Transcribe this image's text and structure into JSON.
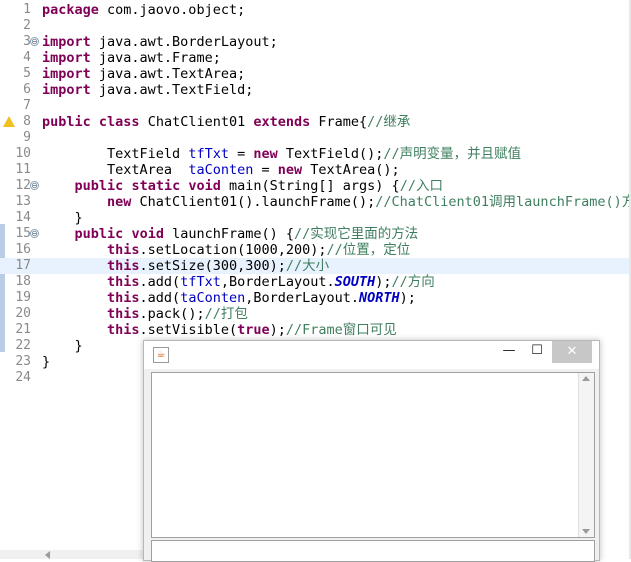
{
  "editor": {
    "lines": [
      {
        "n": "1",
        "segs": [
          {
            "t": "package",
            "c": "kw"
          },
          {
            "t": " com.jaovo.object;",
            "c": ""
          }
        ]
      },
      {
        "n": "2",
        "segs": []
      },
      {
        "n": "3",
        "fold": "⊖",
        "segs": [
          {
            "t": "import",
            "c": "kw"
          },
          {
            "t": " java.awt.BorderLayout;",
            "c": ""
          }
        ]
      },
      {
        "n": "4",
        "segs": [
          {
            "t": "import",
            "c": "kw"
          },
          {
            "t": " java.awt.Frame;",
            "c": ""
          }
        ]
      },
      {
        "n": "5",
        "segs": [
          {
            "t": "import",
            "c": "kw"
          },
          {
            "t": " java.awt.TextArea;",
            "c": ""
          }
        ]
      },
      {
        "n": "6",
        "segs": [
          {
            "t": "import",
            "c": "kw"
          },
          {
            "t": " java.awt.TextField;",
            "c": ""
          }
        ]
      },
      {
        "n": "7",
        "segs": []
      },
      {
        "n": "8",
        "warn": true,
        "segs": [
          {
            "t": "public",
            "c": "kw"
          },
          {
            "t": " ",
            "c": ""
          },
          {
            "t": "class",
            "c": "kw"
          },
          {
            "t": " ChatClient01 ",
            "c": ""
          },
          {
            "t": "extends",
            "c": "kw"
          },
          {
            "t": " Frame{",
            "c": ""
          },
          {
            "t": "//继承",
            "c": "cm"
          }
        ]
      },
      {
        "n": "9",
        "segs": []
      },
      {
        "n": "10",
        "segs": [
          {
            "t": "        TextField ",
            "c": ""
          },
          {
            "t": "tfTxt",
            "c": "fld"
          },
          {
            "t": " = ",
            "c": ""
          },
          {
            "t": "new",
            "c": "kw"
          },
          {
            "t": " TextField();",
            "c": ""
          },
          {
            "t": "//声明变量，并且赋值",
            "c": "cm"
          }
        ]
      },
      {
        "n": "11",
        "segs": [
          {
            "t": "        TextArea  ",
            "c": ""
          },
          {
            "t": "taConten",
            "c": "fld"
          },
          {
            "t": " = ",
            "c": ""
          },
          {
            "t": "new",
            "c": "kw"
          },
          {
            "t": " TextArea();",
            "c": ""
          }
        ]
      },
      {
        "n": "12",
        "fold": "⊖",
        "segs": [
          {
            "t": "    ",
            "c": ""
          },
          {
            "t": "public",
            "c": "kw"
          },
          {
            "t": " ",
            "c": ""
          },
          {
            "t": "static",
            "c": "kw"
          },
          {
            "t": " ",
            "c": ""
          },
          {
            "t": "void",
            "c": "kw"
          },
          {
            "t": " main(String[] args) {",
            "c": ""
          },
          {
            "t": "//入口",
            "c": "cm"
          }
        ]
      },
      {
        "n": "13",
        "segs": [
          {
            "t": "        ",
            "c": ""
          },
          {
            "t": "new",
            "c": "kw"
          },
          {
            "t": " ChatClient01().launchFrame();",
            "c": ""
          },
          {
            "t": "//ChatClient01调用launchFrame()方",
            "c": "cm"
          }
        ]
      },
      {
        "n": "14",
        "segs": [
          {
            "t": "    }",
            "c": ""
          }
        ]
      },
      {
        "n": "15",
        "fold": "⊖",
        "segs": [
          {
            "t": "    ",
            "c": ""
          },
          {
            "t": "public",
            "c": "kw"
          },
          {
            "t": " ",
            "c": ""
          },
          {
            "t": "void",
            "c": "kw"
          },
          {
            "t": " launchFrame() {",
            "c": ""
          },
          {
            "t": "//实现它里面的方法",
            "c": "cm"
          }
        ]
      },
      {
        "n": "16",
        "segs": [
          {
            "t": "        ",
            "c": ""
          },
          {
            "t": "this",
            "c": "kw"
          },
          {
            "t": ".setLocation(1000,200);",
            "c": ""
          },
          {
            "t": "//位置，定位",
            "c": "cm"
          }
        ]
      },
      {
        "n": "17",
        "cur": true,
        "segs": [
          {
            "t": "        ",
            "c": ""
          },
          {
            "t": "this",
            "c": "kw"
          },
          {
            "t": ".setSize(300,300);",
            "c": ""
          },
          {
            "t": "//大小",
            "c": "cm"
          }
        ]
      },
      {
        "n": "18",
        "segs": [
          {
            "t": "        ",
            "c": ""
          },
          {
            "t": "this",
            "c": "kw"
          },
          {
            "t": ".add(",
            "c": ""
          },
          {
            "t": "tfTxt",
            "c": "fld"
          },
          {
            "t": ",BorderLayout.",
            "c": ""
          },
          {
            "t": "SOUTH",
            "c": "sf"
          },
          {
            "t": ");",
            "c": ""
          },
          {
            "t": "//方向",
            "c": "cm"
          }
        ]
      },
      {
        "n": "19",
        "segs": [
          {
            "t": "        ",
            "c": ""
          },
          {
            "t": "this",
            "c": "kw"
          },
          {
            "t": ".add(",
            "c": ""
          },
          {
            "t": "taConten",
            "c": "fld"
          },
          {
            "t": ",BorderLayout.",
            "c": ""
          },
          {
            "t": "NORTH",
            "c": "sf"
          },
          {
            "t": ");",
            "c": ""
          }
        ]
      },
      {
        "n": "20",
        "segs": [
          {
            "t": "        ",
            "c": ""
          },
          {
            "t": "this",
            "c": "kw"
          },
          {
            "t": ".pack();",
            "c": ""
          },
          {
            "t": "//打包",
            "c": "cm"
          }
        ]
      },
      {
        "n": "21",
        "segs": [
          {
            "t": "        ",
            "c": ""
          },
          {
            "t": "this",
            "c": "kw"
          },
          {
            "t": ".setVisible(",
            "c": ""
          },
          {
            "t": "true",
            "c": "kw"
          },
          {
            "t": ");",
            "c": ""
          },
          {
            "t": "//Frame窗口可见",
            "c": "cm"
          }
        ]
      },
      {
        "n": "22",
        "segs": [
          {
            "t": "    }",
            "c": ""
          }
        ]
      },
      {
        "n": "23",
        "segs": [
          {
            "t": "}",
            "c": ""
          }
        ]
      },
      {
        "n": "24",
        "segs": []
      }
    ]
  },
  "frame_window": {
    "icon": "java-icon",
    "minimize_label": "—",
    "maximize_label": "☐",
    "close_label": "✕"
  },
  "colors": {
    "keyword": "#7f0055",
    "field": "#0000c0",
    "comment": "#3f7f5f",
    "current_line": "#e8f2fe"
  }
}
